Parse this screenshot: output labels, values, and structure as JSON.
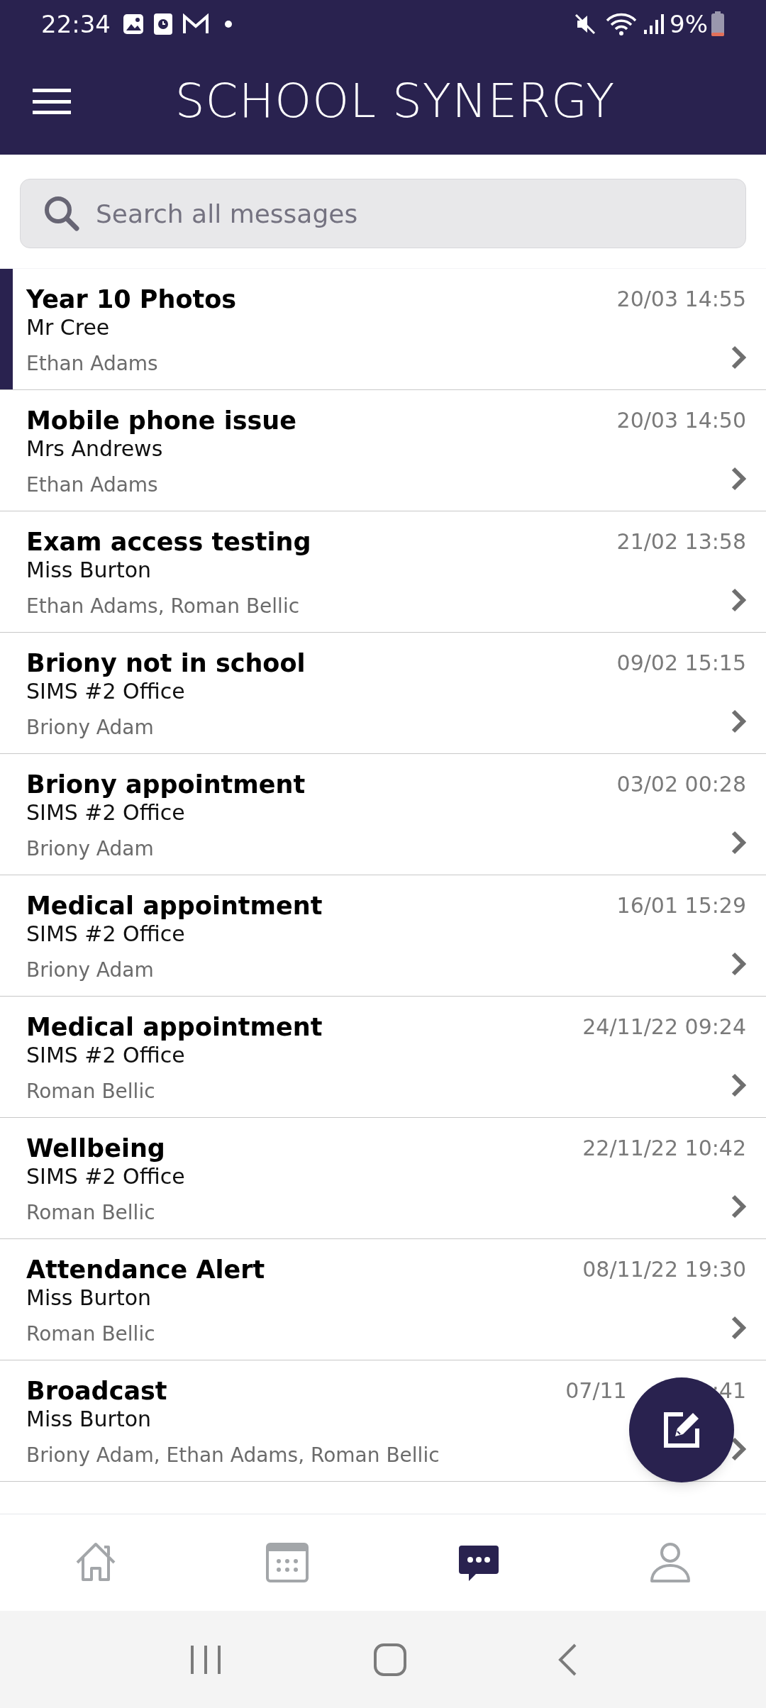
{
  "status_bar": {
    "time": "22:34",
    "battery": "9%"
  },
  "header": {
    "logo": "SCHOOL SYNERGY"
  },
  "search": {
    "placeholder": "Search all messages"
  },
  "messages": [
    {
      "subject": "Year 10 Photos",
      "sender": "Mr Cree",
      "recipients": "Ethan Adams",
      "date": "20/03 14:55",
      "selected": true
    },
    {
      "subject": "Mobile phone issue",
      "sender": "Mrs Andrews",
      "recipients": "Ethan Adams",
      "date": "20/03 14:50",
      "selected": false
    },
    {
      "subject": "Exam access testing",
      "sender": "Miss Burton",
      "recipients": "Ethan Adams, Roman Bellic",
      "date": "21/02 13:58",
      "selected": false
    },
    {
      "subject": "Briony not in school",
      "sender": "SIMS #2 Office",
      "recipients": "Briony Adam",
      "date": "09/02 15:15",
      "selected": false
    },
    {
      "subject": "Briony appointment",
      "sender": "SIMS #2 Office",
      "recipients": "Briony Adam",
      "date": "03/02 00:28",
      "selected": false
    },
    {
      "subject": "Medical appointment",
      "sender": "SIMS #2 Office",
      "recipients": "Briony Adam",
      "date": "16/01 15:29",
      "selected": false
    },
    {
      "subject": "Medical appointment",
      "sender": "SIMS #2 Office",
      "recipients": "Roman Bellic",
      "date": "24/11/22 09:24",
      "selected": false
    },
    {
      "subject": "Wellbeing",
      "sender": "SIMS #2 Office",
      "recipients": "Roman Bellic",
      "date": "22/11/22 10:42",
      "selected": false
    },
    {
      "subject": "Attendance Alert",
      "sender": "Miss Burton",
      "recipients": "Roman Bellic",
      "date": "08/11/22 19:30",
      "selected": false
    },
    {
      "subject": "Broadcast",
      "sender": "Miss Burton",
      "recipients": "Briony Adam, Ethan Adams, Roman Bellic",
      "date": "07/11",
      "date_end": ":41",
      "selected": false
    }
  ],
  "bottom_nav": [
    {
      "kind": "home",
      "selected": false
    },
    {
      "kind": "calendar",
      "selected": false
    },
    {
      "kind": "messages",
      "selected": true
    },
    {
      "kind": "profile",
      "selected": false
    }
  ]
}
